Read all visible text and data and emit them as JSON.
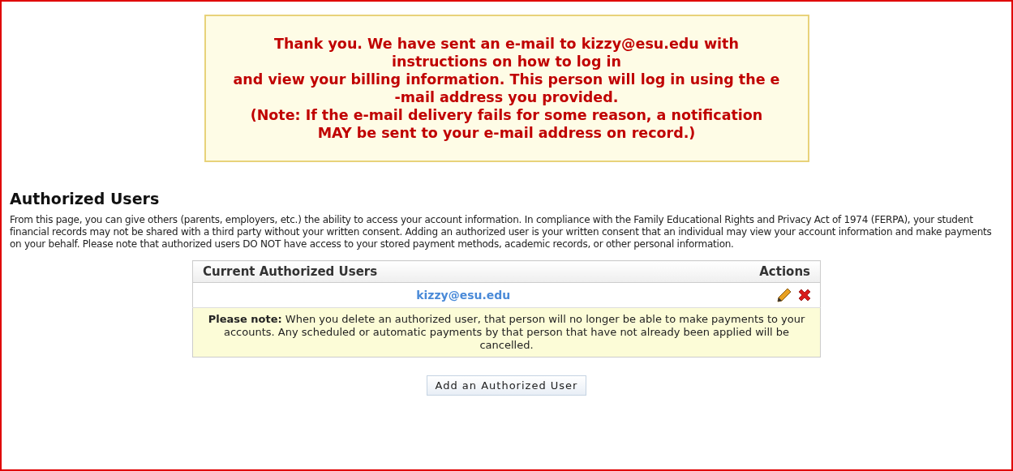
{
  "confirmation": {
    "lines": [
      "Thank you. We have sent an e-mail to kizzy@esu.edu with",
      "instructions on how to log in",
      "and view your billing information. This person will log in using the e",
      "-mail address you provided.",
      "(Note: If the e-mail delivery fails for some reason, a notification",
      "MAY be sent to your e-mail address on record.)"
    ]
  },
  "heading": "Authorized Users",
  "description": "From this page, you can give others (parents, employers, etc.) the ability to access your account information. In compliance with the Family Educational Rights and Privacy Act of 1974 (FERPA), your student financial records may not be shared with a third party without your written consent. Adding an authorized user is your written consent that an individual may view your account information and make payments on your behalf. Please note that authorized users DO NOT have access to your stored payment methods, academic records, or other personal information.",
  "table": {
    "columns": [
      "Current Authorized Users",
      "Actions"
    ],
    "rows": [
      {
        "email": "kizzy@esu.edu"
      }
    ],
    "note": "**Please note:** When you delete an authorized user, that person will no longer be able to make payments to your accounts. Any scheduled or automatic payments by that person that have not already been applied will be cancelled."
  },
  "add_button": "Add an Authorized User"
}
